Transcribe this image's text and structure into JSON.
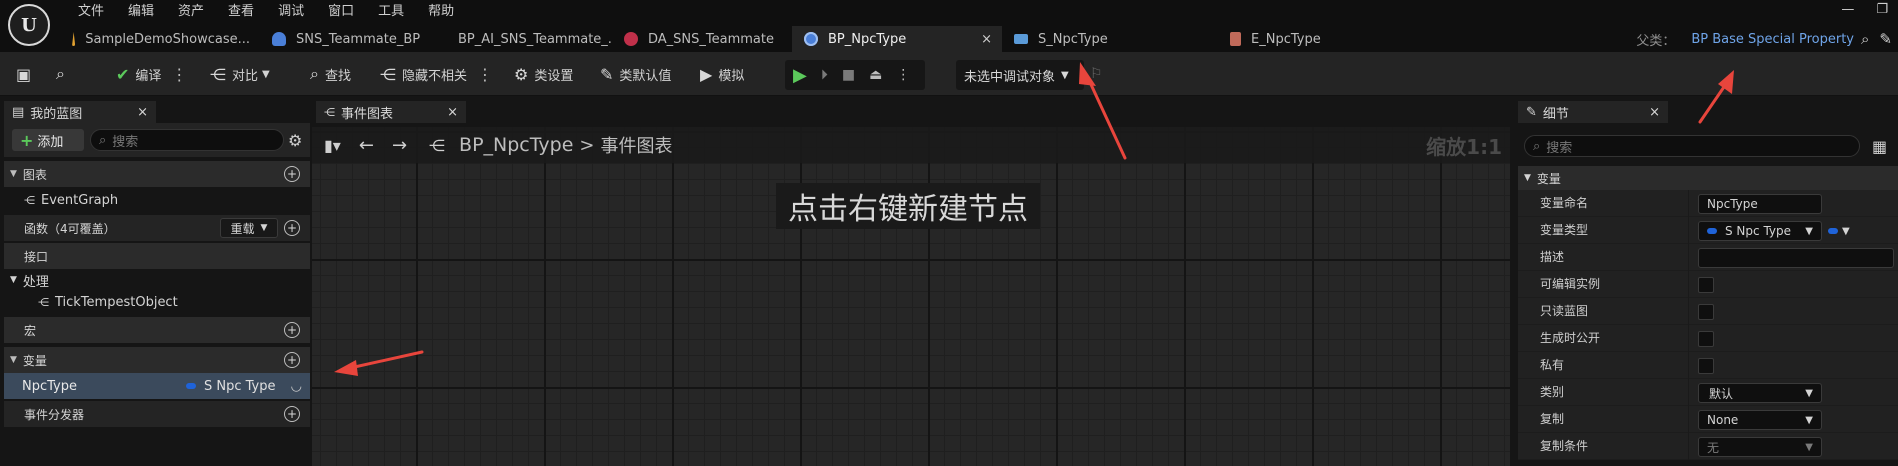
{
  "menu": [
    "文件",
    "编辑",
    "资产",
    "查看",
    "调试",
    "窗口",
    "工具",
    "帮助"
  ],
  "window_controls": [
    "—",
    "❐"
  ],
  "tabs": [
    {
      "label": "SampleDemoShowcase...",
      "icon_color": "#e0a030"
    },
    {
      "label": "SNS_Teammate_BP",
      "icon_color": "#4a7fd8"
    },
    {
      "label": "BP_AI_SNS_Teammate_...",
      "icon_color": "#4a7fd8"
    },
    {
      "label": "DA_SNS_Teammate",
      "icon_color": "#c0304a"
    },
    {
      "label": "BP_NpcType",
      "icon_color": "#4a7fd8",
      "active": true,
      "close": "×"
    },
    {
      "label": "S_NpcType",
      "icon_color": "#5a9ad8"
    },
    {
      "label": "E_NpcType",
      "icon_color": "#c06a5a"
    }
  ],
  "parent": {
    "label": "父类：",
    "value": "BP Base Special Property"
  },
  "toolbar": {
    "compile": "编译",
    "diff": "对比",
    "find": "查找",
    "hide_unrelated": "隐藏不相关",
    "class_settings": "类设置",
    "class_defaults": "类默认值",
    "simulate": "模拟",
    "debug_select": "未选中调试对象"
  },
  "my_blueprint": {
    "tab_label": "我的蓝图",
    "add_label": "添加",
    "search_placeholder": "搜索",
    "sections": {
      "graphs": "图表",
      "event_graph": "EventGraph",
      "functions": "函数（4可覆盖）",
      "override": "重载",
      "interfaces": "接口",
      "handling": "处理",
      "tick_tempest": "TickTempestObject",
      "macros": "宏",
      "variables": "变量",
      "dispatchers": "事件分发器"
    },
    "variable": {
      "name": "NpcType",
      "type": "S Npc Type"
    }
  },
  "graph": {
    "tab_label": "事件图表",
    "breadcrumb_root": "BP_NpcType",
    "breadcrumb_sep": ">",
    "breadcrumb_leaf": "事件图表",
    "zoom": "缩放1:1",
    "hint": "点击右键新建节点"
  },
  "details": {
    "tab_label": "细节",
    "search_placeholder": "搜索",
    "section": "变量",
    "rows": {
      "var_name_label": "变量命名",
      "var_name_value": "NpcType",
      "var_type_label": "变量类型",
      "var_type_value": "S Npc Type",
      "desc_label": "描述",
      "instance_editable": "可编辑实例",
      "blueprint_readonly": "只读蓝图",
      "expose_on_spawn": "生成时公开",
      "private": "私有",
      "category_label": "类别",
      "category_value": "默认",
      "replication_label": "复制",
      "replication_value": "None",
      "rep_condition_label": "复制条件",
      "rep_condition_value": "无"
    }
  },
  "colors": {
    "accent_blue": "#6fa4e8",
    "struct_pin": "#1f63d9",
    "arrow_red": "#e8453c",
    "play_green": "#5bc95b"
  }
}
